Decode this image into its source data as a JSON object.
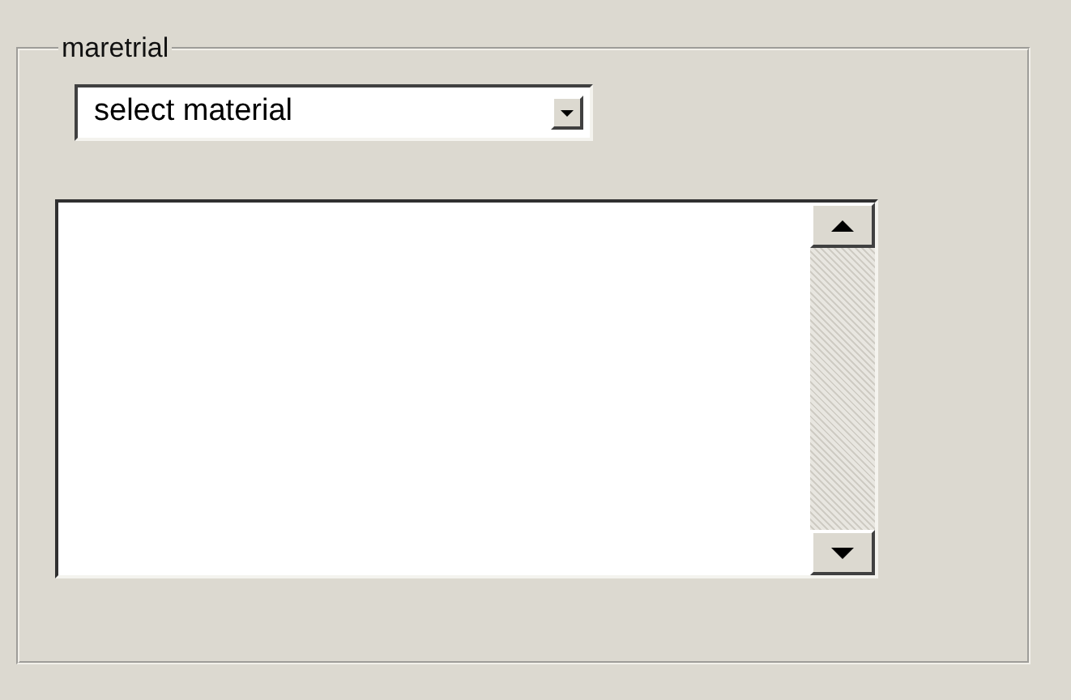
{
  "group": {
    "title": "maretrial"
  },
  "material_select": {
    "value": "select material"
  }
}
